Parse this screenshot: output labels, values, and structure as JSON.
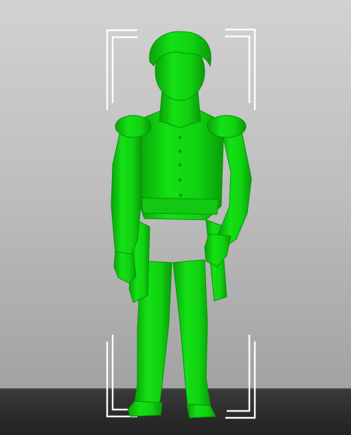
{
  "viewport": {
    "model_name": "",
    "selected": true,
    "colors": {
      "background_top": "#d2d2d2",
      "background_bottom": "#9b9b9b",
      "floor": "#2a2a2a",
      "model": "#0fdf0f",
      "model_shadow": "#0a9e0a",
      "selection_bracket": "#ffffff"
    },
    "icons": [
      "selection-bracket-icon"
    ]
  }
}
